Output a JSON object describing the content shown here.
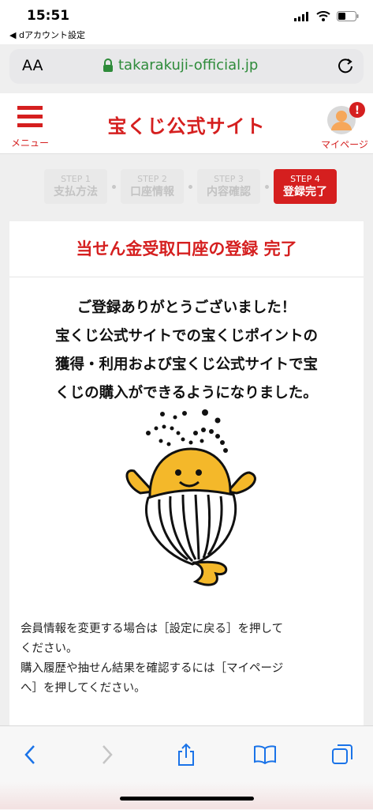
{
  "status": {
    "time": "15:51",
    "back_app": "◀ dアカウント設定"
  },
  "browser": {
    "aa": "AA",
    "url": "takarakuji-official.jp"
  },
  "header": {
    "menu_label": "メニュー",
    "logo": "宝くじ公式サイト",
    "mypage_label": "マイページ",
    "badge": "!"
  },
  "steps": [
    {
      "num": "STEP 1",
      "label": "支払方法",
      "active": false
    },
    {
      "num": "STEP 2",
      "label": "口座情報",
      "active": false
    },
    {
      "num": "STEP 3",
      "label": "内容確認",
      "active": false
    },
    {
      "num": "STEP 4",
      "label": "登録完了",
      "active": true
    }
  ],
  "card": {
    "title": "当せん金受取口座の登録 完了",
    "thanks_lines": [
      "ご登録ありがとうございました！",
      "宝くじ公式サイトでの宝くじポイントの",
      "獲得・利用および宝くじ公式サイトで宝",
      "くじの購入ができるようになりました。"
    ],
    "info_lines": [
      "会員情報を変更する場合は［設定に戻る］を押して",
      "ください。",
      "購入履歴や抽せん結果を確認するには［マイページ",
      "へ］を押してください。"
    ]
  },
  "colors": {
    "accent": "#d51f1f",
    "url_green": "#2e8b3a",
    "ios_blue": "#1a73e8"
  }
}
